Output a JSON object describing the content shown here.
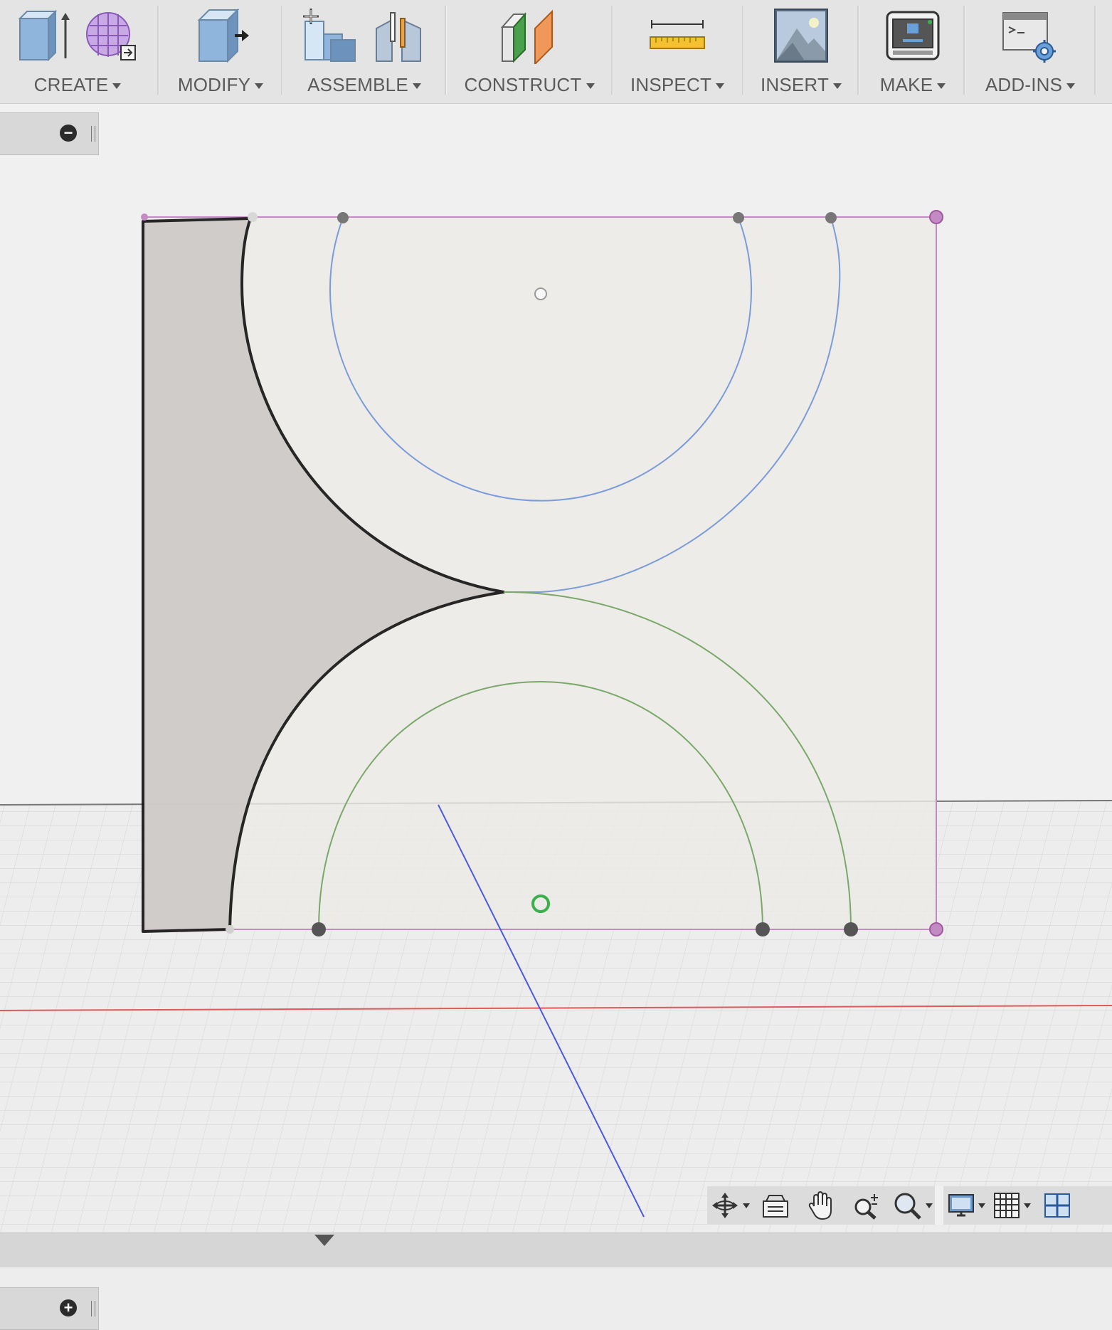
{
  "toolbar": {
    "groups": [
      {
        "label": "CREATE",
        "icons": [
          "extrude-box-icon",
          "form-cage-icon"
        ]
      },
      {
        "label": "MODIFY",
        "icons": [
          "press-pull-icon"
        ]
      },
      {
        "label": "ASSEMBLE",
        "icons": [
          "new-component-icon",
          "joint-icon"
        ]
      },
      {
        "label": "CONSTRUCT",
        "icons": [
          "offset-plane-icon"
        ]
      },
      {
        "label": "INSPECT",
        "icons": [
          "measure-icon"
        ]
      },
      {
        "label": "INSERT",
        "icons": [
          "insert-image-icon"
        ]
      },
      {
        "label": "MAKE",
        "icons": [
          "3d-print-icon"
        ]
      },
      {
        "label": "ADD-INS",
        "icons": [
          "scripts-icon"
        ]
      }
    ]
  },
  "panels": {
    "top": {
      "control": "collapse",
      "icon": "minus-icon"
    },
    "bottom": {
      "control": "expand",
      "icon": "plus-icon"
    }
  },
  "navbar": {
    "tools": [
      "orbit-icon",
      "look-at-icon",
      "pan-icon",
      "zoom-icon",
      "fit-icon",
      "display-settings-icon",
      "grid-settings-icon",
      "viewports-icon"
    ]
  },
  "colors": {
    "toolbar_bg": "#e4e4e4",
    "sketch_plane": "#edeae7",
    "profile_fill": "#cdc9c7",
    "plane_border": "#c48ac4",
    "blue_arc": "#7a9cdc",
    "green_arc": "#7aa86a",
    "x_axis": "#e05a5a",
    "z_axis": "#4a5ae0"
  }
}
